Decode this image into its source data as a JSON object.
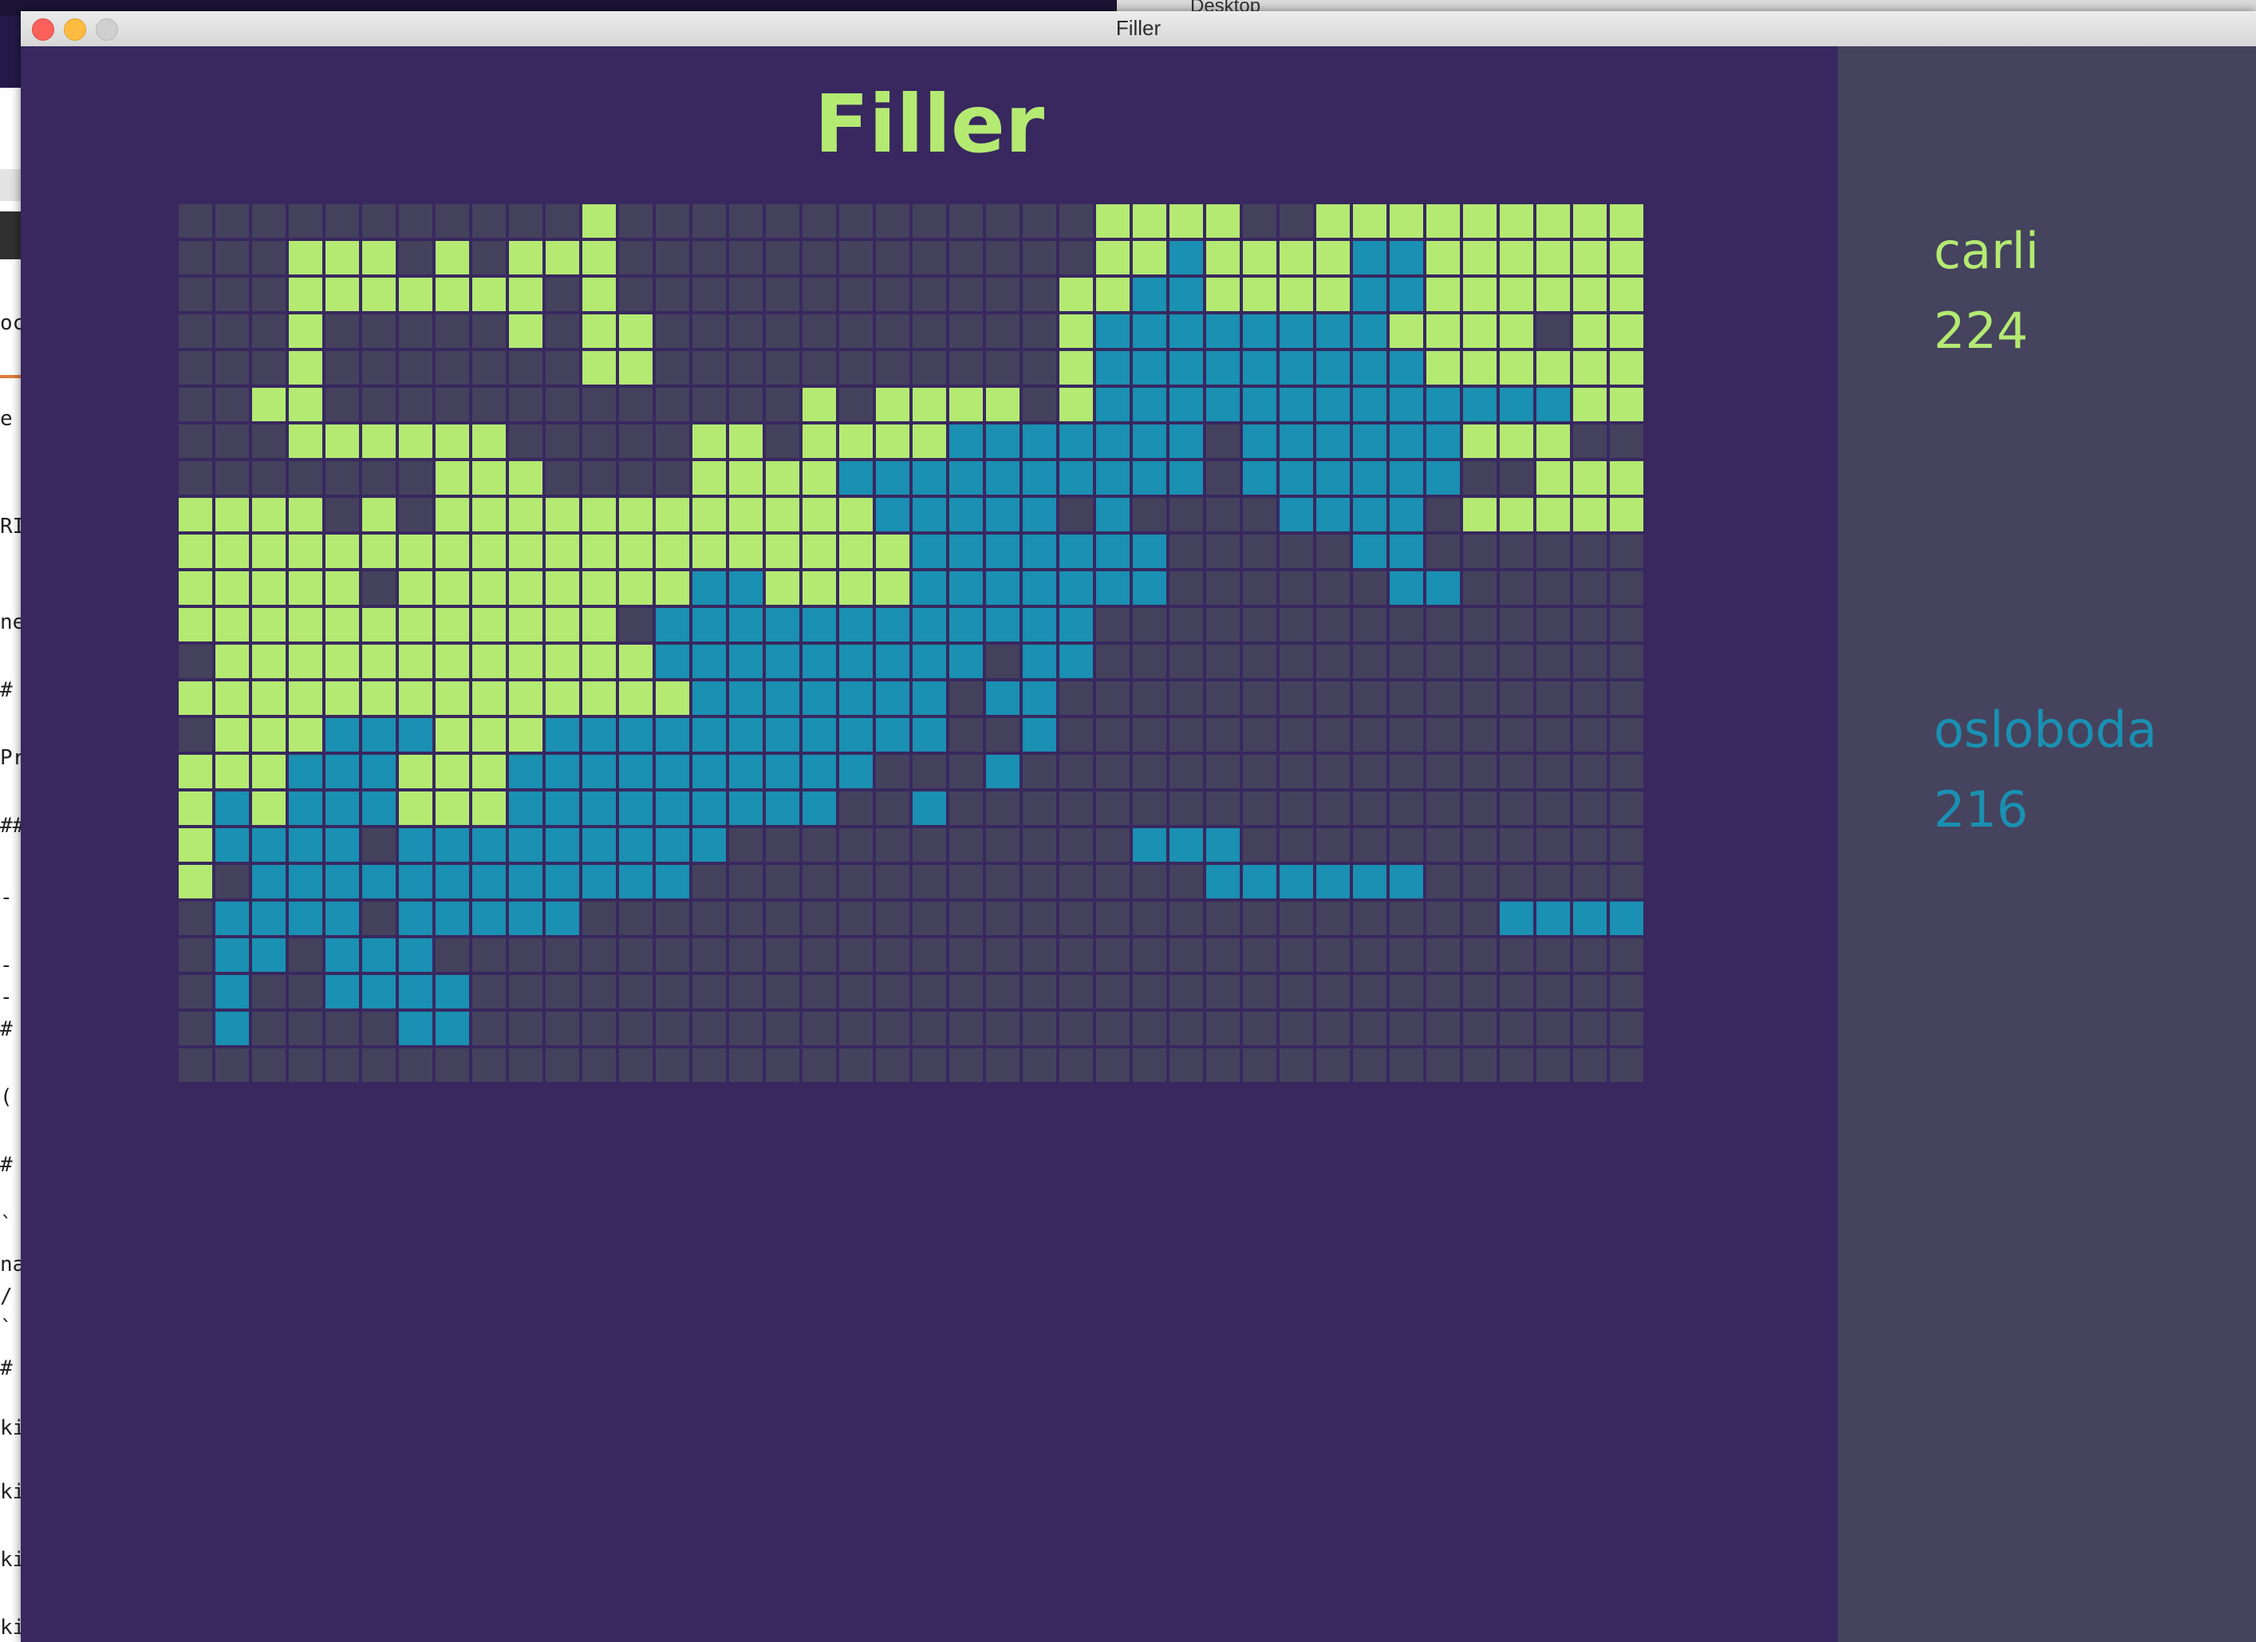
{
  "window": {
    "title": "Filler"
  },
  "background_windows": {
    "titlebar_fragment": "Desktop",
    "left_fragments": [
      "oc",
      "e",
      "RI",
      "ne",
      "#",
      "Pr",
      "##",
      "-",
      "-",
      "-",
      "# S",
      "(",
      "# (",
      "`",
      "na",
      "/",
      "`",
      "# (",
      "ki",
      "ki",
      "ki",
      "ki"
    ]
  },
  "game": {
    "title": "Filler",
    "board": {
      "rows": 24,
      "cols": 40,
      "legend": {
        ".": "empty",
        "A": "player1",
        "B": "player2"
      },
      "grid": [
        "...........A.............AAAA..AAAAAAAAAAA",
        "...AAA.A.AAA.............AABAAAABBAAAAAAAA",
        "...AAAAAAA.A............AABBAAAABBAAAAAAAA",
        "...A.....A.AA...........ABBBBBBBBAAAA.AAA.",
        "...A.......AA...........ABBBBBBBBBAAAAAAA.",
        "..AA.............A.AAAA.ABBBBBBBBBBBBBAAA.",
        "...AAAAAA.....AA.AAAABBBBBBB.BBBBBBAAA.",
        ".......AAA....AAAABBBBBBBBBB.BBBBBB..AAA",
        "AAAA.A.AAAAAAAAAAAABBBBB.B....BBBB.AAAAAA.",
        "AAAAAAAAAAAAAAAAAAAABBBBBBB.....BB......A.",
        "AAAAA.AAAAAAAABBAAAABBBBBBB......BB.......A.",
        "AAAAAAAAAAAA.BBBBBBBBBBBB.",
        ".AAAAAAAAAAAABBBBBBBBB.BB",
        "AAAAAAAAAAAAAABBBBBBB.BB",
        ".AAABBBAAABBBBBBBBBBB..B",
        "AAABBBAAABBBBBBBBBB...B",
        "ABABBBAAABBBBBBBBB..B",
        "ABBBB.BBBBBBBBB...........BBB",
        "A.BBBBBBBBBBBB..............BBBBBB",
        ".BBBB.BBBBB.........................BBBB",
        ".BB.BBB",
        ".B..BBBB",
        ".B....BB",
        ""
      ]
    }
  },
  "players": [
    {
      "name": "carli",
      "score": "224",
      "color": "#b4ea72"
    },
    {
      "name": "osloboda",
      "score": "216",
      "color": "#1a90b2"
    }
  ],
  "colors": {
    "empty_cell": "#44415d",
    "board_bg": "#38285f",
    "panel_bg": "#45435d"
  }
}
